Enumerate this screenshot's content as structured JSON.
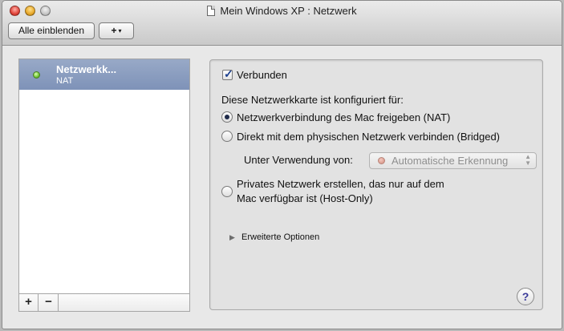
{
  "window": {
    "title": "Mein Windows XP : Netzwerk"
  },
  "toolbar": {
    "show_all_label": "Alle einblenden",
    "add_menu_label": "+",
    "add_menu_caret": "▾"
  },
  "sidebar": {
    "items": [
      {
        "name": "Netzwerkk...",
        "subtitle": "NAT",
        "status_color": "#6fc534"
      }
    ],
    "add_label": "+",
    "remove_label": "−"
  },
  "panel": {
    "connected_label": "Verbunden",
    "connected_checked": true,
    "configured_for_label": "Diese Netzwerkkarte ist konfiguriert für:",
    "options": [
      {
        "label": "Netzwerkverbindung des Mac freigeben (NAT)",
        "selected": true
      },
      {
        "label": "Direkt mit dem physischen Netzwerk verbinden (Bridged)",
        "selected": false
      },
      {
        "label_line1": "Privates Netzwerk erstellen, das nur auf dem",
        "label_line2": "Mac verfügbar ist (Host-Only)",
        "selected": false
      }
    ],
    "using_label": "Unter Verwendung von:",
    "using_value": "Automatische Erkennung",
    "using_disabled": true,
    "advanced_label": "Erweiterte Optionen",
    "help_label": "?"
  },
  "colors": {
    "selection": "#8ea0c2",
    "window_bg": "#e8e8e8"
  }
}
